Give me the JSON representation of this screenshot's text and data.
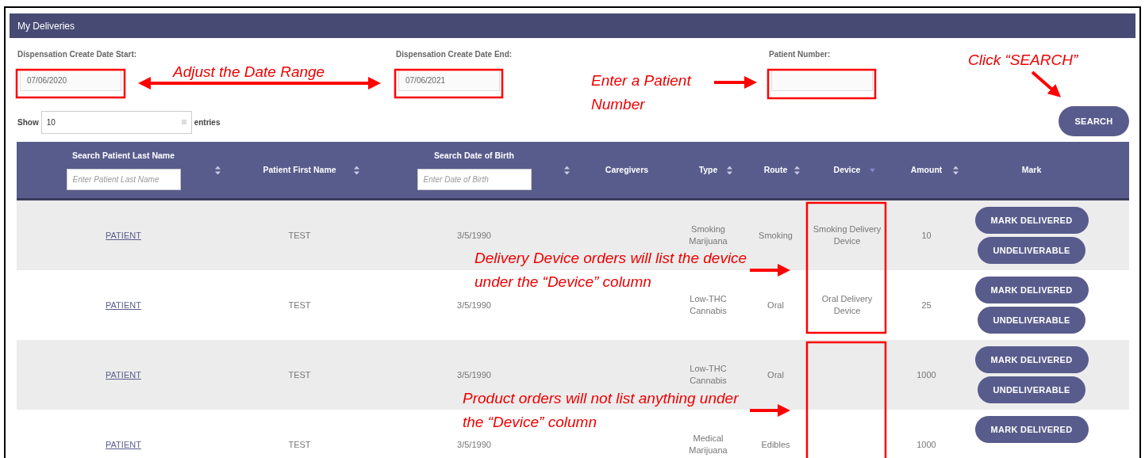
{
  "window": {
    "title": "My Deliveries"
  },
  "filters": [
    {
      "label": "Dispensation Create Date Start:",
      "value": "07/06/2020"
    },
    {
      "label": "Dispensation Create Date End:",
      "value": "07/06/2021"
    },
    {
      "label": "Patient Number:"
    }
  ],
  "page_length": {
    "prefix": "Show",
    "value": "10",
    "suffix": "entries"
  },
  "search_button": "SEARCH",
  "table": {
    "columns": [
      {
        "kind": "sortable",
        "label": "Search Patient Last Name",
        "placeholder": "Enter Patient Last Name"
      },
      {
        "kind": "sortable",
        "label": "Patient First Name"
      },
      {
        "kind": "sortable",
        "label": "Search Date of Birth",
        "placeholder": "Enter Date of Birth"
      },
      {
        "kind": "plain",
        "label": "Caregivers"
      },
      {
        "kind": "sortable",
        "label": "Type"
      },
      {
        "kind": "sortable",
        "label": "Route"
      },
      {
        "kind": "sorted",
        "label": "Device"
      },
      {
        "kind": "sortable",
        "label": "Amount"
      },
      {
        "kind": "plain",
        "label": "Mark"
      }
    ],
    "rows": [
      {
        "last_name": "PATIENT",
        "first_name": "TEST",
        "dob": "3/5/1990",
        "type": "Smoking Marijuana",
        "route": "Smoking",
        "device": "Smoking Delivery Device",
        "amount": "10",
        "buttons": [
          "MARK DELIVERED",
          "UNDELIVERABLE"
        ]
      },
      {
        "last_name": "PATIENT",
        "first_name": "TEST",
        "dob": "3/5/1990",
        "type": "Low-THC Cannabis",
        "route": "Oral",
        "device": "Oral Delivery Device",
        "amount": "25",
        "buttons": [
          "MARK DELIVERED",
          "UNDELIVERABLE"
        ]
      },
      {
        "last_name": "PATIENT",
        "first_name": "TEST",
        "dob": "3/5/1990",
        "type": "Low-THC Cannabis",
        "route": "Oral",
        "amount": "1000",
        "buttons": [
          "MARK DELIVERED",
          "UNDELIVERABLE"
        ]
      },
      {
        "last_name": "PATIENT",
        "first_name": "TEST",
        "dob": "3/5/1990",
        "type": "Medical Marijuana",
        "route": "Edibles",
        "amount": "1000",
        "buttons": [
          "MARK DELIVERED"
        ]
      }
    ]
  },
  "annotations": [
    {
      "text": "Adjust the Date Range"
    },
    {
      "text": "Enter a Patient Number"
    },
    {
      "text": "Click “SEARCH”"
    },
    {
      "text": "Delivery Device orders will list the device under the “Device” column"
    },
    {
      "text": "Product orders will not list anything under the “Device” column"
    }
  ]
}
